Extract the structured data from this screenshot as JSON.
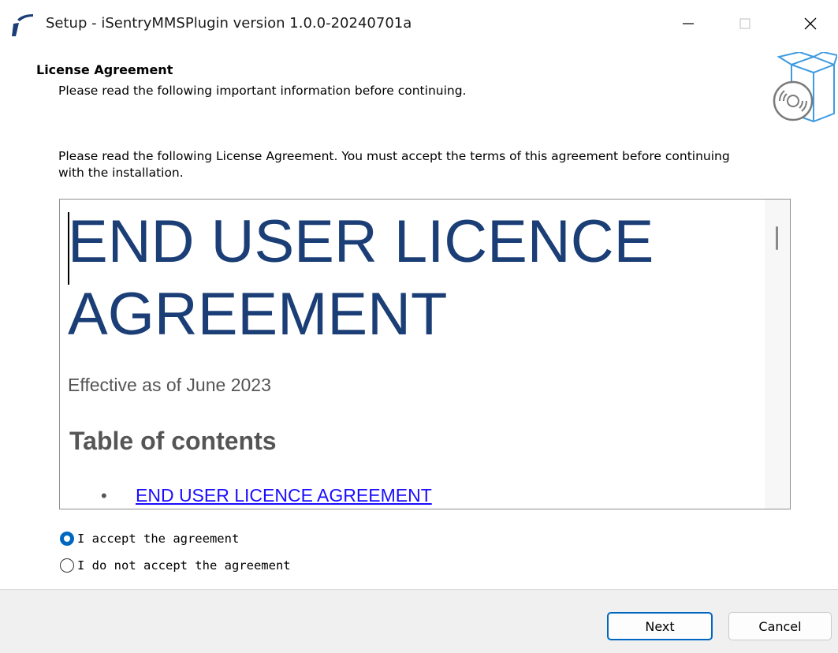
{
  "window": {
    "title": "Setup - iSentryMMSPlugin version 1.0.0-20240701a",
    "icon": "app-logo-icon"
  },
  "header": {
    "title": "License Agreement",
    "subtitle": "Please read the following important information before continuing."
  },
  "intro": "Please read the following License Agreement. You must accept the terms of this agreement before continuing with the installation.",
  "license": {
    "heading": "END USER LICENCE AGREEMENT",
    "effective": "Effective as of June 2023",
    "toc_heading": "Table of contents",
    "toc_bullet": "•",
    "toc_items": [
      "END USER LICENCE AGREEMENT"
    ]
  },
  "options": {
    "accept": "I accept the agreement",
    "decline": "I do not accept the agreement",
    "selected": "accept"
  },
  "buttons": {
    "next": "Next",
    "cancel": "Cancel"
  },
  "colors": {
    "accent": "#0067c0",
    "heading": "#1a3e75",
    "link": "#1a0dff"
  }
}
